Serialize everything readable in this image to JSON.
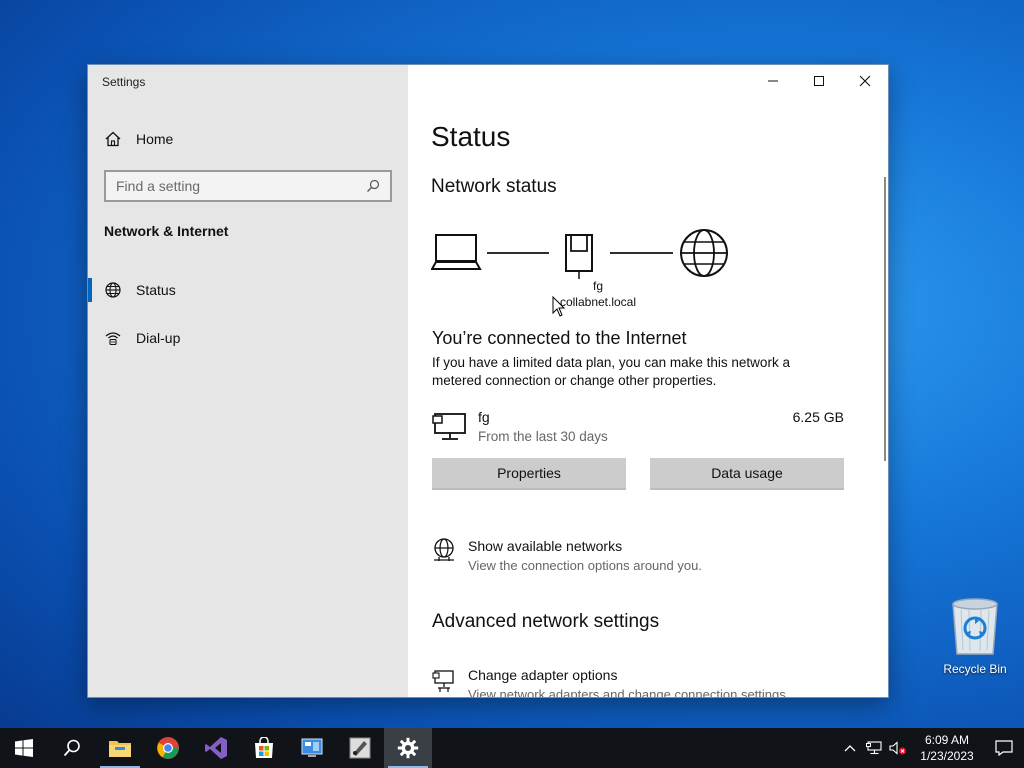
{
  "window": {
    "title": "Settings"
  },
  "sidebar": {
    "home_label": "Home",
    "search_placeholder": "Find a setting",
    "section_title": "Network & Internet",
    "items": [
      {
        "label": "Status",
        "icon": "globe-icon",
        "active": true
      },
      {
        "label": "Dial-up",
        "icon": "dialup-icon",
        "active": false
      }
    ]
  },
  "main": {
    "title": "Status",
    "network_status_heading": "Network status",
    "network_name": "fg",
    "network_domain": "collabnet.local",
    "connected_title": "You’re connected to the Internet",
    "connected_desc": "If you have a limited data plan, you can make this network a metered connection or change other properties.",
    "data": {
      "name": "fg",
      "period": "From the last 30 days",
      "usage": "6.25 GB"
    },
    "buttons": {
      "properties": "Properties",
      "data_usage": "Data usage"
    },
    "show_networks": {
      "title": "Show available networks",
      "subtitle": "View the connection options around you."
    },
    "advanced_heading": "Advanced network settings",
    "change_adapter": {
      "title": "Change adapter options",
      "subtitle": "View network adapters and change connection settings."
    }
  },
  "desktop": {
    "recycle_bin_label": "Recycle Bin"
  },
  "taskbar": {
    "apps": [
      "start-icon",
      "search-icon",
      "file-explorer-icon",
      "chrome-icon",
      "visual-studio-icon",
      "store-icon",
      "control-panel-icon",
      "paint-icon",
      "settings-icon"
    ],
    "time": "6:09 AM",
    "date": "1/23/2023"
  },
  "colors": {
    "accent": "#0067c0",
    "sidebar_bg": "#e6e6e6",
    "button_bg": "#cccccc",
    "taskbar_bg": "#101418"
  }
}
